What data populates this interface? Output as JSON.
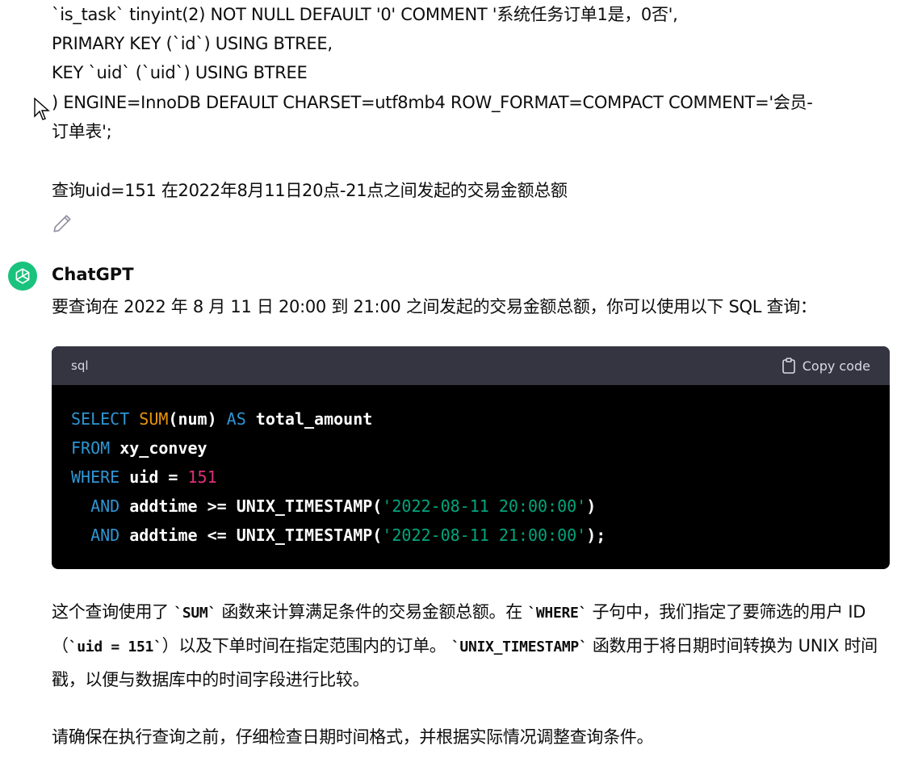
{
  "user_message": {
    "ddl_lines": [
      " `is_task` tinyint(2) NOT NULL DEFAULT '0' COMMENT '系统任务订单1是，0否',",
      " PRIMARY KEY (`id`) USING BTREE,",
      " KEY `uid` (`uid`) USING BTREE",
      ") ENGINE=InnoDB DEFAULT CHARSET=utf8mb4 ROW_FORMAT=COMPACT COMMENT='会员-",
      "订单表';"
    ],
    "question": "查询uid=151 在2022年8月11日20点-21点之间发起的交易金额总额",
    "edit_icon": "pencil-icon"
  },
  "assistant": {
    "author": "ChatGPT",
    "avatar_icon": "openai-logo-icon",
    "avatar_color": "#19c37d",
    "intro": "要查询在 2022 年 8 月 11 日 20:00 到 21:00 之间发起的交易金额总额，你可以使用以下 SQL 查询：",
    "code_block": {
      "language": "sql",
      "copy_label": "Copy code",
      "copy_icon": "clipboard-icon",
      "lines": [
        [
          {
            "t": "SELECT ",
            "c": "kw"
          },
          {
            "t": "SUM",
            "c": "fn2"
          },
          {
            "t": "(num) ",
            "c": ""
          },
          {
            "t": "AS",
            "c": "kw"
          },
          {
            "t": " total_amount",
            "c": ""
          }
        ],
        [
          {
            "t": "FROM",
            "c": "kw"
          },
          {
            "t": " xy_convey",
            "c": ""
          }
        ],
        [
          {
            "t": "WHERE",
            "c": "kw"
          },
          {
            "t": " uid = ",
            "c": ""
          },
          {
            "t": "151",
            "c": "num"
          }
        ],
        [
          {
            "t": "  AND",
            "c": "kw"
          },
          {
            "t": " addtime >= UNIX_TIMESTAMP(",
            "c": ""
          },
          {
            "t": "'2022-08-11 20:00:00'",
            "c": "str"
          },
          {
            "t": ")",
            "c": ""
          }
        ],
        [
          {
            "t": "  AND",
            "c": "kw"
          },
          {
            "t": " addtime <= UNIX_TIMESTAMP(",
            "c": ""
          },
          {
            "t": "'2022-08-11 21:00:00'",
            "c": "str"
          },
          {
            "t": ");",
            "c": ""
          }
        ]
      ]
    },
    "explanation_parts": [
      {
        "t": "这个查询使用了 ",
        "code": false
      },
      {
        "t": "`SUM`",
        "code": true
      },
      {
        "t": " 函数来计算满足条件的交易金额总额。在 ",
        "code": false
      },
      {
        "t": "`WHERE`",
        "code": true
      },
      {
        "t": " 子句中，我们指定了要筛选的用户 ID（",
        "code": false
      },
      {
        "t": "`uid = 151`",
        "code": true
      },
      {
        "t": "）以及下单时间在指定范围内的订单。 ",
        "code": false
      },
      {
        "t": "`UNIX_TIMESTAMP`",
        "code": true
      },
      {
        "t": " 函数用于将日期时间转换为 UNIX 时间戳，以便与数据库中的时间字段进行比较。",
        "code": false
      }
    ],
    "note": "请确保在执行查询之前，仔细检查日期时间格式，并根据实际情况调整查询条件。"
  },
  "colors": {
    "code_bg": "#000000",
    "code_header_bg": "#343541",
    "keyword": "#2e95d3",
    "function": "#e9950c",
    "number": "#df3079",
    "string": "#00a67d"
  }
}
